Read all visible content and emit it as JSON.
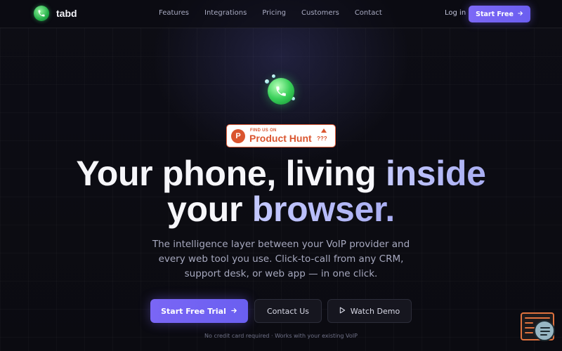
{
  "nav": {
    "brand": "tabd",
    "links": [
      "Features",
      "Integrations",
      "Pricing",
      "Customers",
      "Contact"
    ],
    "login": "Log in",
    "cta": "Start Free"
  },
  "badge": {
    "small_text": "FIND US ON",
    "big_text": "Product Hunt",
    "count": "???"
  },
  "hero": {
    "line1_plain": "Your phone, living ",
    "line1_accent": "inside",
    "line2_plain": "your ",
    "line2_accent": "browser.",
    "subtext": "The intelligence layer between your VoIP provider and every web tool you use. Click-to-call from any CRM, support desk, or web app — in one click.",
    "primary_cta": "Start Free Trial",
    "secondary_cta": "Contact Us",
    "demo_cta": "Watch Demo",
    "footnote": "No credit card required · Works with your existing VoIP"
  },
  "colors": {
    "accent": "#7a66f5",
    "background": "#0c0c13",
    "brand_green": "#3ad05a",
    "producthunt": "#da552f"
  },
  "icons": {
    "brand": "phone-bubble-icon",
    "cta_arrow": "arrow-right-icon",
    "demo": "play-icon",
    "widget": "chat-widget-icon"
  }
}
